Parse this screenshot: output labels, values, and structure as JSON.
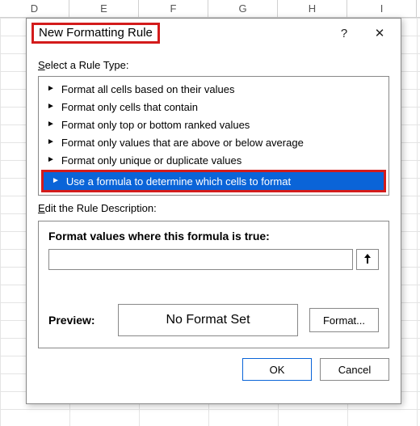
{
  "columns": [
    "D",
    "E",
    "F",
    "G",
    "H",
    "I"
  ],
  "dialog": {
    "title": "New Formatting Rule",
    "help_glyph": "?",
    "close_glyph": "✕",
    "select_label_pre": "S",
    "select_label_rest": "elect a Rule Type:",
    "rule_types": [
      "Format all cells based on their values",
      "Format only cells that contain",
      "Format only top or bottom ranked values",
      "Format only values that are above or below average",
      "Format only unique or duplicate values",
      "Use a formula to determine which cells to format"
    ],
    "selected_index": 5,
    "edit_label_pre": "E",
    "edit_label_rest": "dit the Rule Description:",
    "formula_header": "Format values where this formula is true:",
    "formula_value": "",
    "preview_label": "Preview:",
    "preview_text": "No Format Set",
    "format_button": "Format...",
    "ok": "OK",
    "cancel": "Cancel"
  }
}
